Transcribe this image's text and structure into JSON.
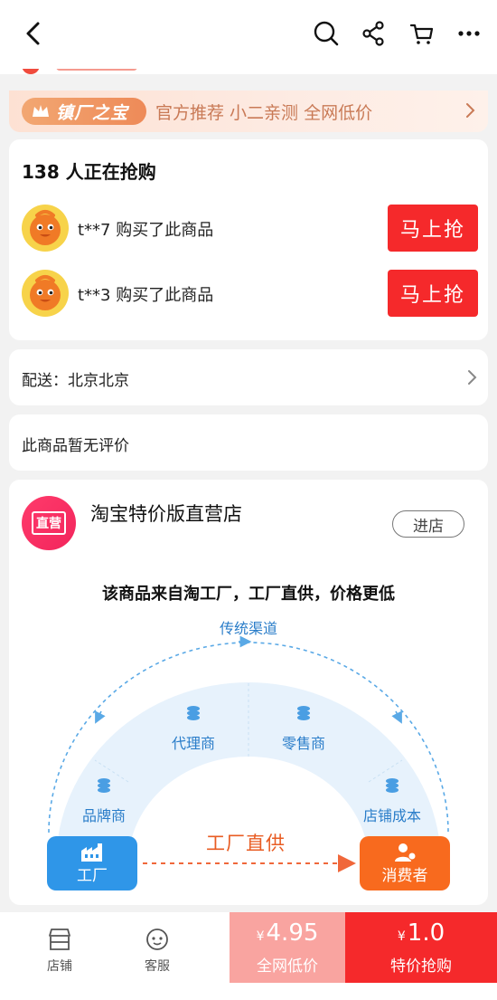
{
  "header": {
    "icons": [
      "back-icon",
      "search-icon",
      "share-icon",
      "cart-icon",
      "more-icon"
    ]
  },
  "banner": {
    "badge_label": "镇厂之宝",
    "promo_text": "官方推荐 小二亲测 全网低价"
  },
  "buyers": {
    "headline": "138 人正在抢购",
    "entries": [
      {
        "text": "t**7 购买了此商品",
        "button": "马上抢"
      },
      {
        "text": "t**3 购买了此商品",
        "button": "马上抢"
      }
    ]
  },
  "shipping": {
    "label": "配送：北京北京"
  },
  "review": {
    "label": "此商品暂无评价"
  },
  "store": {
    "logo_text": "直营",
    "name": "淘宝特价版直营店",
    "enter_button": "进店",
    "headline": "该商品来自淘工厂，工厂直供，价格更低",
    "diagram": {
      "traditional_label": "传统渠道",
      "nodes": [
        "品牌商",
        "代理商",
        "零售商",
        "店铺成本"
      ],
      "factory_label": "工厂",
      "consumer_label": "消费者",
      "direct_label": "工厂直供"
    }
  },
  "bottom_bar": {
    "store_tab": "店铺",
    "service_tab": "客服",
    "low_price": {
      "currency": "¥",
      "amount": "4.95",
      "label": "全网低价"
    },
    "special_price": {
      "currency": "¥",
      "amount": "1.0",
      "label": "特价抢购"
    }
  },
  "colors": {
    "accent_red": "#f5292b",
    "light_red": "#f9a4a0",
    "orange": "#f86a1e",
    "blue": "#2f96e8",
    "diagram_text_blue": "#2a7dc9"
  }
}
